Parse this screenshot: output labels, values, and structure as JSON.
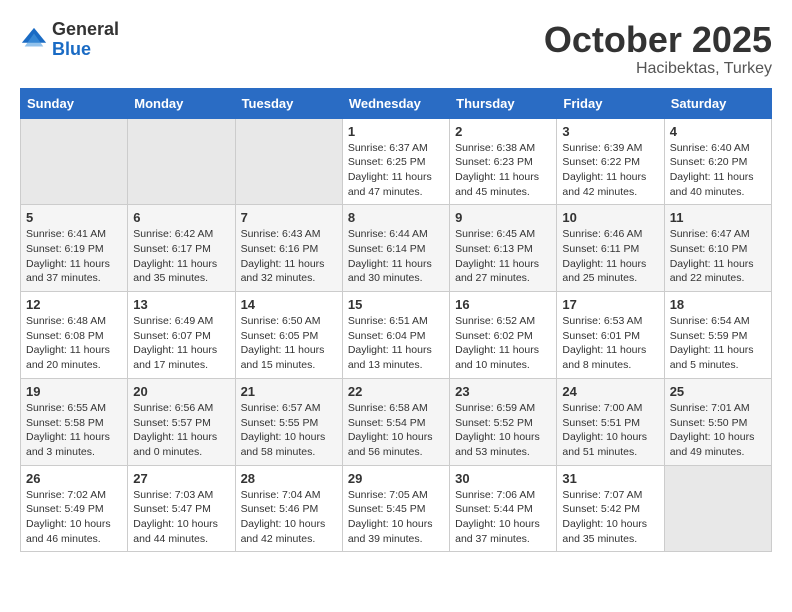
{
  "logo": {
    "general": "General",
    "blue": "Blue"
  },
  "title": "October 2025",
  "location": "Hacibektas, Turkey",
  "days_header": [
    "Sunday",
    "Monday",
    "Tuesday",
    "Wednesday",
    "Thursday",
    "Friday",
    "Saturday"
  ],
  "weeks": [
    [
      {
        "day": "",
        "info": ""
      },
      {
        "day": "",
        "info": ""
      },
      {
        "day": "",
        "info": ""
      },
      {
        "day": "1",
        "info": "Sunrise: 6:37 AM\nSunset: 6:25 PM\nDaylight: 11 hours\nand 47 minutes."
      },
      {
        "day": "2",
        "info": "Sunrise: 6:38 AM\nSunset: 6:23 PM\nDaylight: 11 hours\nand 45 minutes."
      },
      {
        "day": "3",
        "info": "Sunrise: 6:39 AM\nSunset: 6:22 PM\nDaylight: 11 hours\nand 42 minutes."
      },
      {
        "day": "4",
        "info": "Sunrise: 6:40 AM\nSunset: 6:20 PM\nDaylight: 11 hours\nand 40 minutes."
      }
    ],
    [
      {
        "day": "5",
        "info": "Sunrise: 6:41 AM\nSunset: 6:19 PM\nDaylight: 11 hours\nand 37 minutes."
      },
      {
        "day": "6",
        "info": "Sunrise: 6:42 AM\nSunset: 6:17 PM\nDaylight: 11 hours\nand 35 minutes."
      },
      {
        "day": "7",
        "info": "Sunrise: 6:43 AM\nSunset: 6:16 PM\nDaylight: 11 hours\nand 32 minutes."
      },
      {
        "day": "8",
        "info": "Sunrise: 6:44 AM\nSunset: 6:14 PM\nDaylight: 11 hours\nand 30 minutes."
      },
      {
        "day": "9",
        "info": "Sunrise: 6:45 AM\nSunset: 6:13 PM\nDaylight: 11 hours\nand 27 minutes."
      },
      {
        "day": "10",
        "info": "Sunrise: 6:46 AM\nSunset: 6:11 PM\nDaylight: 11 hours\nand 25 minutes."
      },
      {
        "day": "11",
        "info": "Sunrise: 6:47 AM\nSunset: 6:10 PM\nDaylight: 11 hours\nand 22 minutes."
      }
    ],
    [
      {
        "day": "12",
        "info": "Sunrise: 6:48 AM\nSunset: 6:08 PM\nDaylight: 11 hours\nand 20 minutes."
      },
      {
        "day": "13",
        "info": "Sunrise: 6:49 AM\nSunset: 6:07 PM\nDaylight: 11 hours\nand 17 minutes."
      },
      {
        "day": "14",
        "info": "Sunrise: 6:50 AM\nSunset: 6:05 PM\nDaylight: 11 hours\nand 15 minutes."
      },
      {
        "day": "15",
        "info": "Sunrise: 6:51 AM\nSunset: 6:04 PM\nDaylight: 11 hours\nand 13 minutes."
      },
      {
        "day": "16",
        "info": "Sunrise: 6:52 AM\nSunset: 6:02 PM\nDaylight: 11 hours\nand 10 minutes."
      },
      {
        "day": "17",
        "info": "Sunrise: 6:53 AM\nSunset: 6:01 PM\nDaylight: 11 hours\nand 8 minutes."
      },
      {
        "day": "18",
        "info": "Sunrise: 6:54 AM\nSunset: 5:59 PM\nDaylight: 11 hours\nand 5 minutes."
      }
    ],
    [
      {
        "day": "19",
        "info": "Sunrise: 6:55 AM\nSunset: 5:58 PM\nDaylight: 11 hours\nand 3 minutes."
      },
      {
        "day": "20",
        "info": "Sunrise: 6:56 AM\nSunset: 5:57 PM\nDaylight: 11 hours\nand 0 minutes."
      },
      {
        "day": "21",
        "info": "Sunrise: 6:57 AM\nSunset: 5:55 PM\nDaylight: 10 hours\nand 58 minutes."
      },
      {
        "day": "22",
        "info": "Sunrise: 6:58 AM\nSunset: 5:54 PM\nDaylight: 10 hours\nand 56 minutes."
      },
      {
        "day": "23",
        "info": "Sunrise: 6:59 AM\nSunset: 5:52 PM\nDaylight: 10 hours\nand 53 minutes."
      },
      {
        "day": "24",
        "info": "Sunrise: 7:00 AM\nSunset: 5:51 PM\nDaylight: 10 hours\nand 51 minutes."
      },
      {
        "day": "25",
        "info": "Sunrise: 7:01 AM\nSunset: 5:50 PM\nDaylight: 10 hours\nand 49 minutes."
      }
    ],
    [
      {
        "day": "26",
        "info": "Sunrise: 7:02 AM\nSunset: 5:49 PM\nDaylight: 10 hours\nand 46 minutes."
      },
      {
        "day": "27",
        "info": "Sunrise: 7:03 AM\nSunset: 5:47 PM\nDaylight: 10 hours\nand 44 minutes."
      },
      {
        "day": "28",
        "info": "Sunrise: 7:04 AM\nSunset: 5:46 PM\nDaylight: 10 hours\nand 42 minutes."
      },
      {
        "day": "29",
        "info": "Sunrise: 7:05 AM\nSunset: 5:45 PM\nDaylight: 10 hours\nand 39 minutes."
      },
      {
        "day": "30",
        "info": "Sunrise: 7:06 AM\nSunset: 5:44 PM\nDaylight: 10 hours\nand 37 minutes."
      },
      {
        "day": "31",
        "info": "Sunrise: 7:07 AM\nSunset: 5:42 PM\nDaylight: 10 hours\nand 35 minutes."
      },
      {
        "day": "",
        "info": ""
      }
    ]
  ]
}
